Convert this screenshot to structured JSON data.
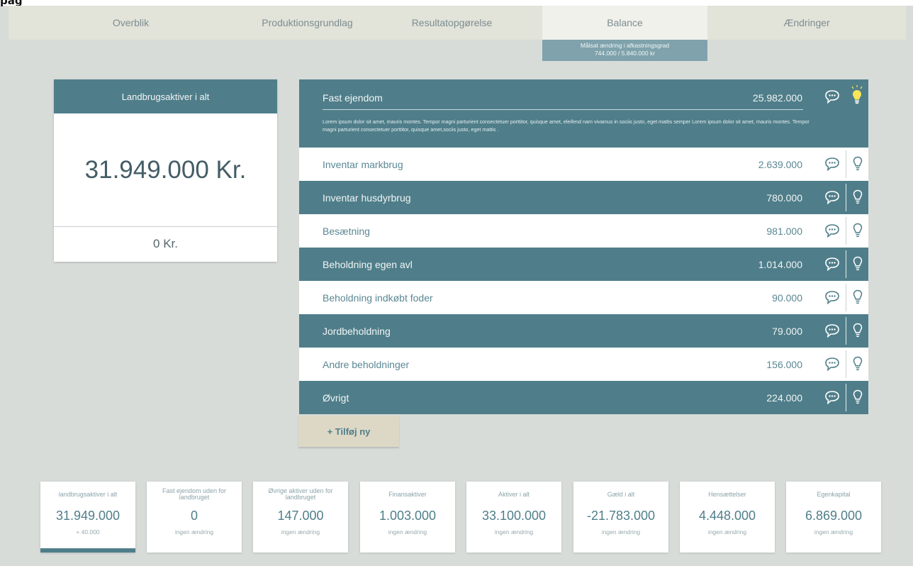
{
  "page_heading": "pag",
  "tabs": [
    {
      "label": "Overblik"
    },
    {
      "label": "Produktionsgrundlag"
    },
    {
      "label": "Resultatopgørelse"
    },
    {
      "label": "Balance",
      "active": true
    },
    {
      "label": "Ændringer"
    }
  ],
  "tab_tip": {
    "line1": "Målsat ændring i afkastningsgrad",
    "line2": "744.000 / 5.840.000 kr"
  },
  "total_card": {
    "title": "Landbrugsaktiver i alt",
    "value": "31.949.000 Kr.",
    "change": "0 Kr."
  },
  "assets": [
    {
      "label": "Fast ejendom",
      "value": "25.982.000",
      "style": "dark",
      "expanded": true,
      "tip_active": true,
      "description": "Lorem ipsum dolor sit amet, mauris montes. Tempor magni parturient consectetuer porttitor, quisque amet, eleifend nam vivamus in sociis justo, eget mattis semper Lorem ipsum dolor sit amet, mauris montes. Tempor magni parturient consectetuer porttitor, quisque amet,sociis justo, eget mattis ."
    },
    {
      "label": "Inventar markbrug",
      "value": "2.639.000",
      "style": "light"
    },
    {
      "label": "Inventar husdyrbrug",
      "value": "780.000",
      "style": "dark"
    },
    {
      "label": "Besætning",
      "value": "981.000",
      "style": "light"
    },
    {
      "label": "Beholdning egen avl",
      "value": "1.014.000",
      "style": "dark"
    },
    {
      "label": "Beholdning indkøbt foder",
      "value": "90.000",
      "style": "light"
    },
    {
      "label": "Jordbeholdning",
      "value": "79.000",
      "style": "dark"
    },
    {
      "label": "Andre beholdninger",
      "value": "156.000",
      "style": "light"
    },
    {
      "label": "Øvrigt",
      "value": "224.000",
      "style": "dark"
    }
  ],
  "add_button": {
    "label": "+ Tilføj ny"
  },
  "summary": [
    {
      "title": "landbrugsaktiver i alt",
      "value": "31.949.000",
      "change": "+ 40.000",
      "active": true
    },
    {
      "title": "Fast ejendom uden for landbruget",
      "value": "0",
      "change": "ingen ændring"
    },
    {
      "title": "Øvrige aktiver uden for landbruget",
      "value": "147.000",
      "change": "ingen ændring"
    },
    {
      "title": "Finansaktiver",
      "value": "1.003.000",
      "change": "ingen ændring"
    },
    {
      "title": "Aktiver i alt",
      "value": "33.100.000",
      "change": "ingen ændring"
    },
    {
      "title": "Gæld i alt",
      "value": "-21.783.000",
      "change": "ingen ændring"
    },
    {
      "title": "Hensættelser",
      "value": "4.448.000",
      "change": "ingen ændring"
    },
    {
      "title": "Egenkapital",
      "value": "6.869.000",
      "change": "ingen ændring"
    }
  ],
  "colors": {
    "teal": "#4f7e8a",
    "background": "#d7dcd9",
    "tab_bar": "#e2e3d9",
    "tip_active": "#f6e45a",
    "button": "#ddd8c6"
  }
}
